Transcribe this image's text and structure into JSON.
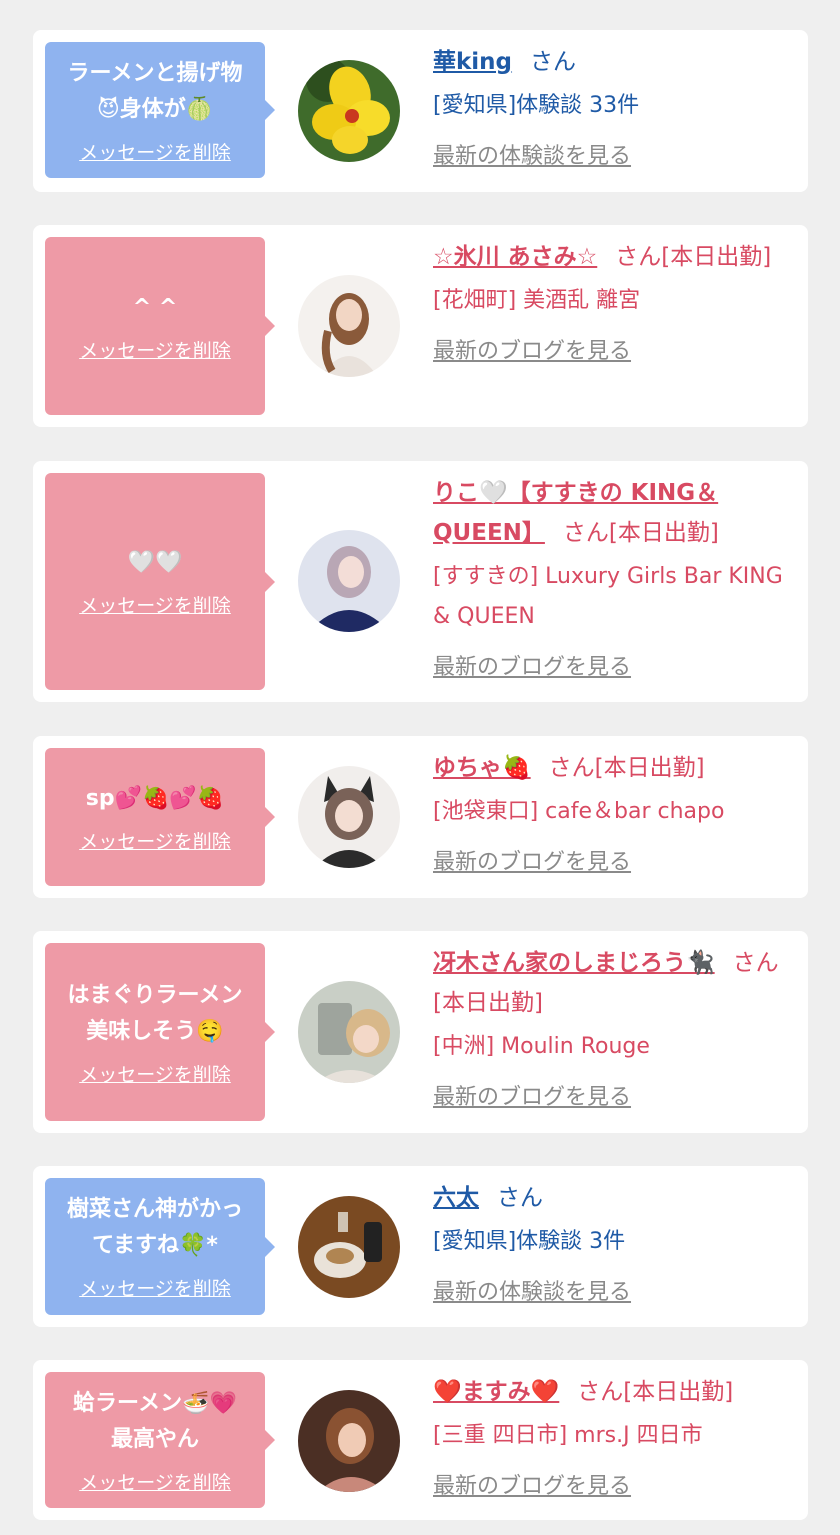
{
  "delete_label": "メッセージを削除",
  "items": [
    {
      "message": "ラーメンと揚げ物\n😈身体が🍈",
      "name": "華king",
      "suffix": "さん",
      "location": "[愛知県]体験談 33件",
      "link": "最新の体験談を見る",
      "theme": "blue"
    },
    {
      "message": "^ ^",
      "name": "☆氷川 あさみ☆",
      "suffix": "さん[本日出勤]",
      "location": "[花畑町] 美酒乱 離宮",
      "link": "最新のブログを見る",
      "theme": "pink"
    },
    {
      "message": "🤍🤍",
      "name": "りこ🤍【すすきの KING＆QUEEN】",
      "suffix": "さん[本日出勤]",
      "location": "[すすきの] Luxury Girls Bar KING & QUEEN",
      "link": "最新のブログを見る",
      "theme": "pink"
    },
    {
      "message": "sp💕🍓💕🍓",
      "name": "ゆちゃ🍓",
      "suffix": "さん[本日出勤]",
      "location": "[池袋東口] cafe＆bar chapo",
      "link": "最新のブログを見る",
      "theme": "pink"
    },
    {
      "message": "はまぐりラーメン\n美味しそう🤤",
      "name": "冴木さん家のしまじろう🐈‍⬛",
      "suffix": "さん[本日出勤]",
      "location": "[中洲] Moulin Rouge",
      "link": "最新のブログを見る",
      "theme": "pink"
    },
    {
      "message": "樹菜さん神がかっ\nてますね🍀*",
      "name": "六太",
      "suffix": "さん",
      "location": "[愛知県]体験談 3件",
      "link": "最新の体験談を見る",
      "theme": "blue"
    },
    {
      "message": "蛤ラーメン🍜💗\n最高やん",
      "name": "❤️ますみ❤️",
      "suffix": "さん[本日出勤]",
      "location": "[三重 四日市] mrs.J 四日市",
      "link": "最新のブログを見る",
      "theme": "pink"
    }
  ]
}
